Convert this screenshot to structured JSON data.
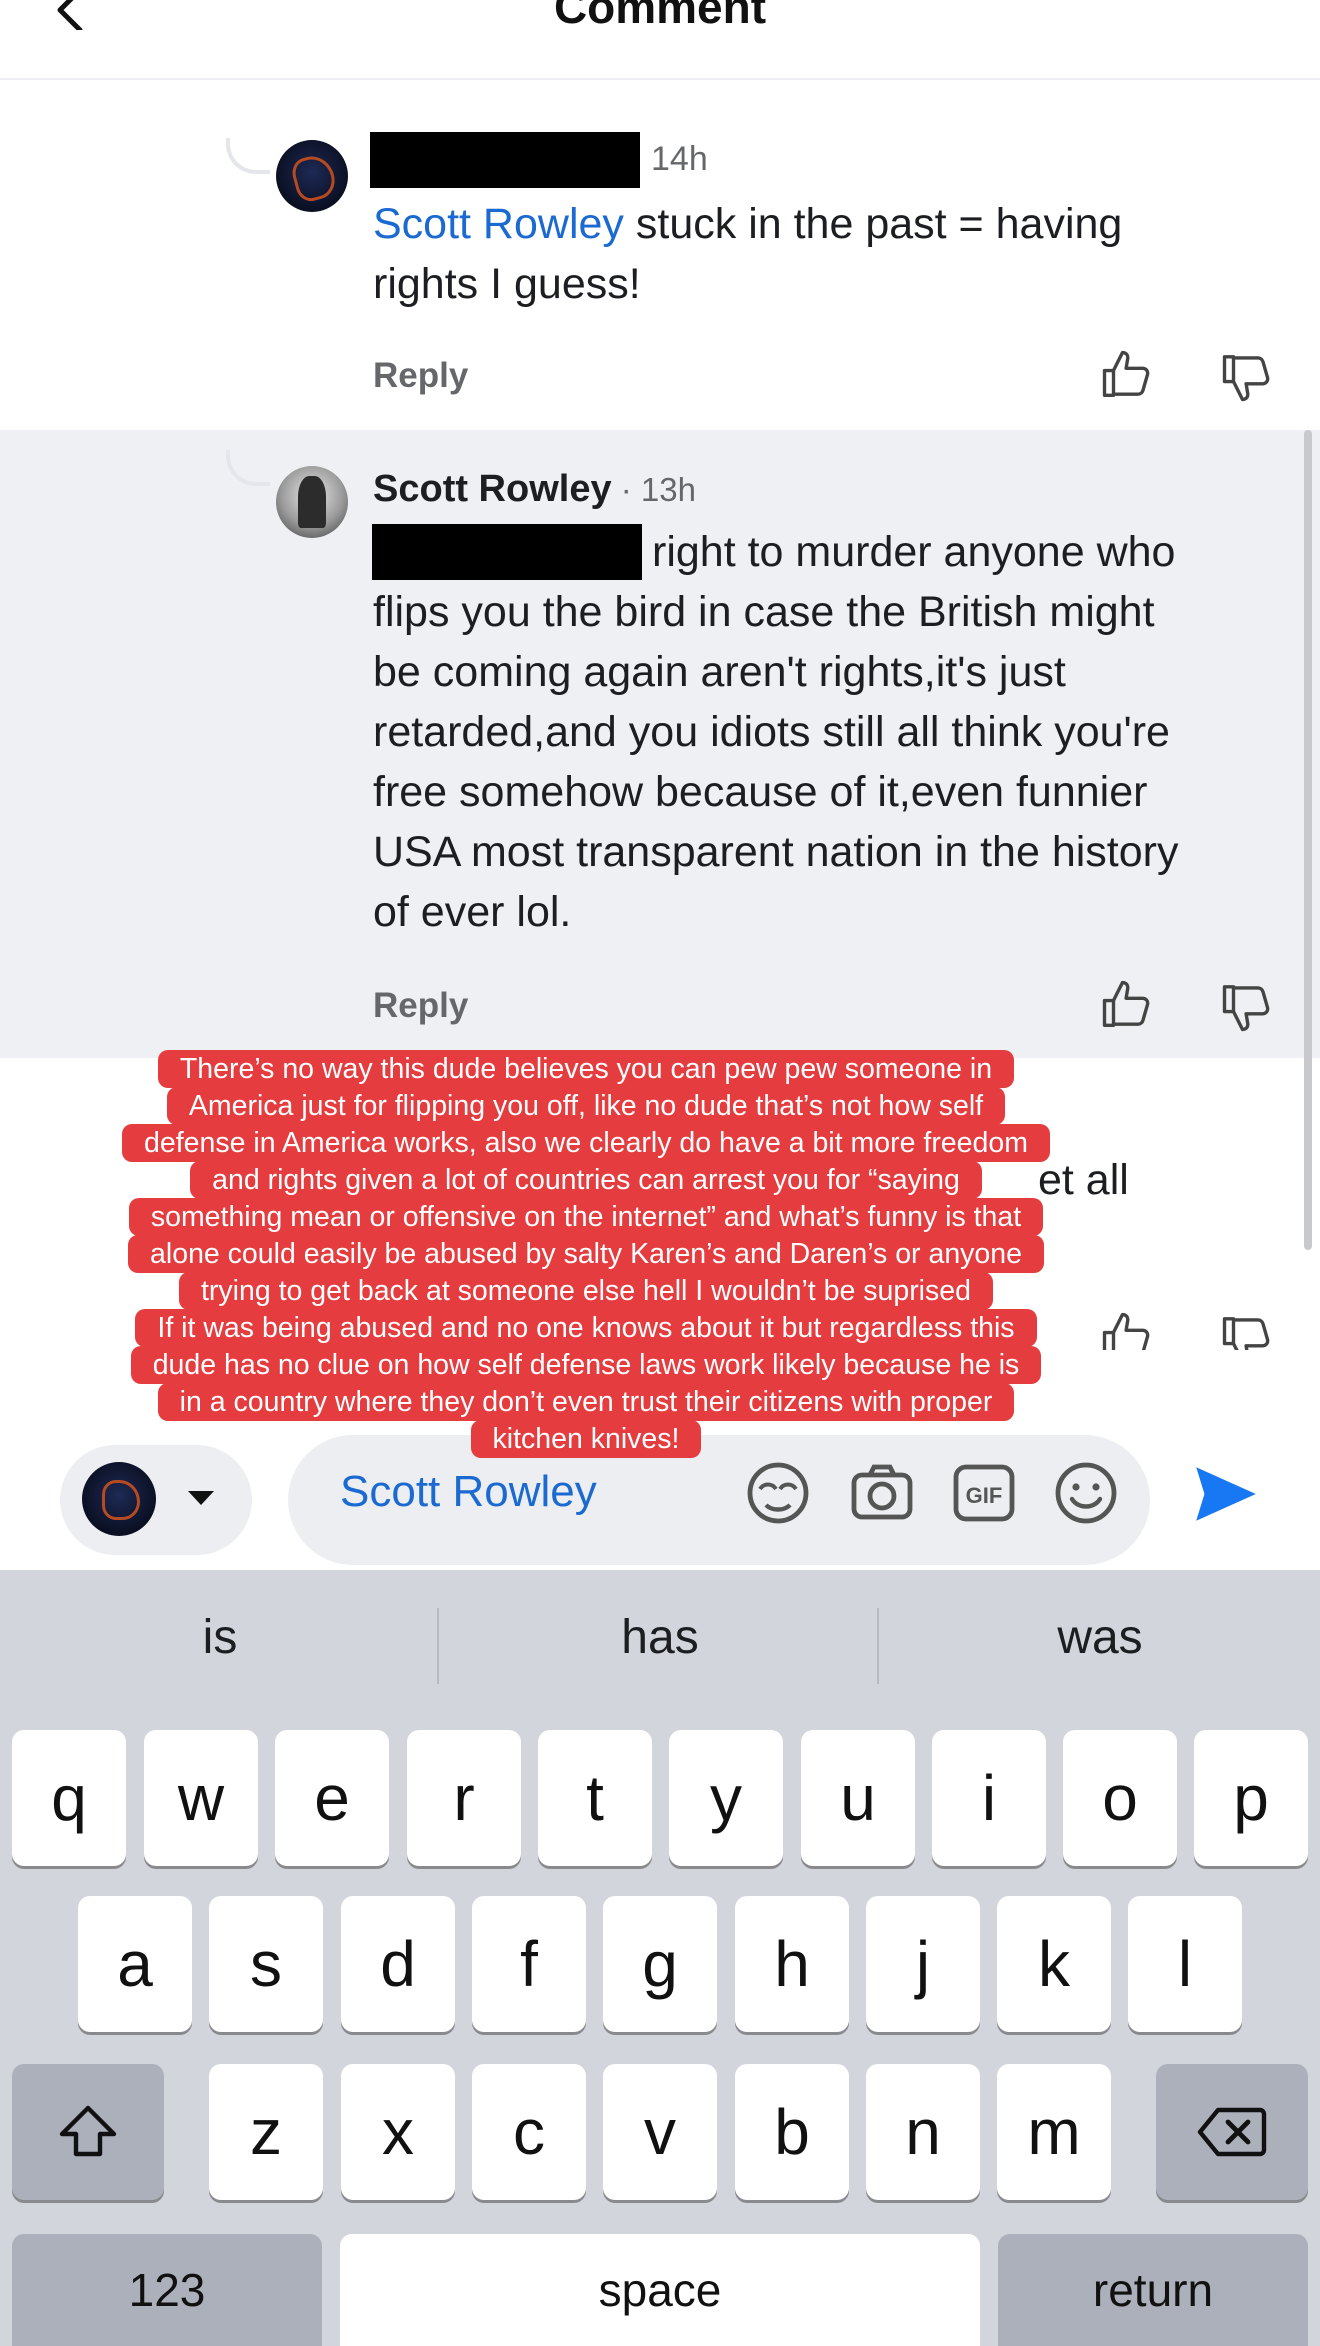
{
  "header": {
    "title": "Comment"
  },
  "comments": [
    {
      "time": "14h",
      "mention": "Scott Rowley",
      "text_line1": " stuck in the past = having",
      "text_line2": "rights I guess!",
      "reply_label": "Reply"
    },
    {
      "author": "Scott Rowley",
      "time": " · 13h",
      "first_line": "right to murder anyone who",
      "lines": [
        "flips you the bird in case the British might",
        "be coming again aren't rights,it's just",
        "retarded,and you idiots still all think you're",
        "free somehow because of it,even funnier",
        "USA most transparent nation in the history",
        "of ever lol."
      ],
      "reply_label": "Reply"
    },
    {
      "partial_text": "et all"
    }
  ],
  "overlay": {
    "lines": [
      "There’s no way this dude believes you can pew pew someone in",
      "America just for flipping you off, like no dude that’s not how self",
      "defense in America works, also we clearly do have a bit more freedom",
      "and rights given a lot of countries can arrest you for “saying",
      "something mean or offensive on the internet” and what’s funny is that",
      "alone could easily be abused by salty Karen’s and Daren’s or anyone",
      "trying to get back at someone else hell I wouldn’t be suprised",
      "If it was being abused and no one knows about it but regardless this",
      "dude has no clue on how self defense laws work likely because he is",
      "in a country where they don’t even trust  their citizens with proper",
      "kitchen knives!"
    ]
  },
  "composer": {
    "input_value": "Scott Rowley",
    "icons": [
      "avatar-sticker-icon",
      "camera-icon",
      "gif-icon",
      "emoji-icon",
      "send-icon"
    ]
  },
  "keyboard": {
    "suggestions": [
      "is",
      "has",
      "was"
    ],
    "row1": [
      "q",
      "w",
      "e",
      "r",
      "t",
      "y",
      "u",
      "i",
      "o",
      "p"
    ],
    "row2": [
      "a",
      "s",
      "d",
      "f",
      "g",
      "h",
      "j",
      "k",
      "l"
    ],
    "row3": [
      "z",
      "x",
      "c",
      "v",
      "b",
      "n",
      "m"
    ],
    "numbers_label": "123",
    "space_label": "space",
    "return_label": "return"
  },
  "colors": {
    "mention": "#1b6ad1",
    "overlay": "#e53d3f",
    "send": "#1877f2"
  }
}
